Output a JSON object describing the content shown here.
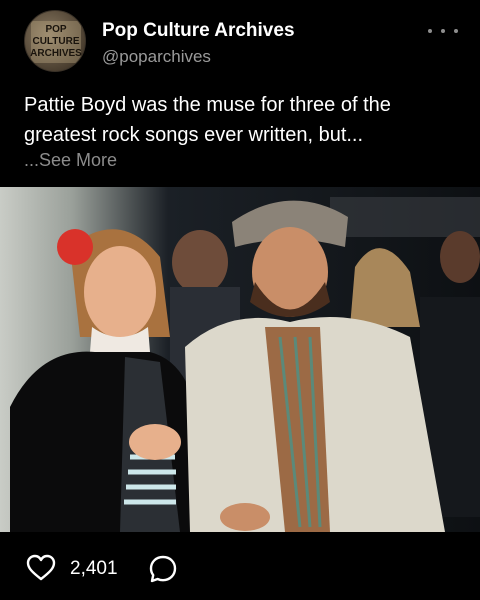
{
  "account": {
    "name": "Pop Culture Archives",
    "handle": "@poparchives",
    "logo_lines": [
      "POP",
      "CULTURE",
      "ARCHIVES"
    ]
  },
  "post": {
    "caption": "Pattie Boyd was the muse for three of the greatest rock songs ever written, but...",
    "see_more": "...See More",
    "photo_alt": "Pattie Boyd and Eric Clapton at an event",
    "likes": "2,401"
  },
  "icons": {
    "more": "more-options-icon",
    "like": "heart-icon",
    "comment": "comment-icon"
  },
  "colors": {
    "background": "#000000",
    "text": "#ffffff",
    "secondary_text": "#9a9a9a",
    "accent_red": "#d9322a"
  }
}
